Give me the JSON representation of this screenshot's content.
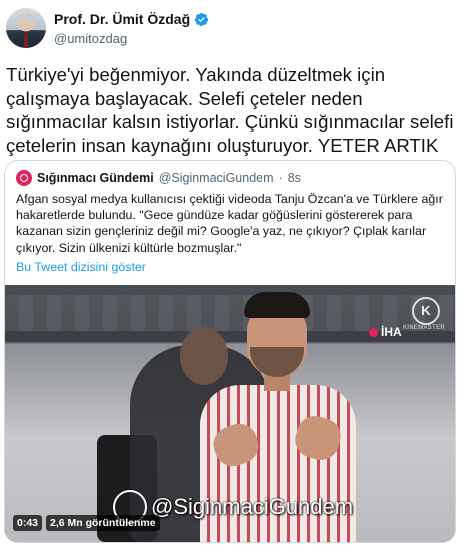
{
  "author": {
    "name": "Prof. Dr. Ümit Özdağ",
    "handle": "@umitozdag",
    "verified_color": "#1d9bf0"
  },
  "tweet": {
    "text": "Türkiye'yi beğenmiyor. Yakında düzeltmek için çalışmaya başlayacak. Selefi çeteler neden sığınmacılar kalsın istiyorlar. Çünkü sığınmacılar selefi çetelerin insan kaynağını oluşturuyor. YETER ARTIK"
  },
  "quoted": {
    "name": "Sığınmacı Gündemi",
    "handle": "@SiginmaciGundem",
    "dot": "·",
    "time": "8s",
    "text": "Afgan sosyal medya kullanıcısı çektiği videoda Tanju Özcan'a ve Türklere ağır hakaretlerde bulundu. \"Gece gündüze kadar göğüslerini göstererek para kazanan sizin gençleriniz değil mi? Google'a yaz, ne çıkıyor? Çıplak karılar çıkıyor. Sizin ülkenizi kültürle bozmuşlar.\"",
    "thread_link": "Bu Tweet dizisini göster",
    "video": {
      "watermark": "@SiginmaciGundem",
      "iha_label": "İHA",
      "k_logo": "K",
      "k_text": "KİNEMASTER",
      "duration": "0:43",
      "views": "2,6 Mn görüntülenme"
    }
  }
}
